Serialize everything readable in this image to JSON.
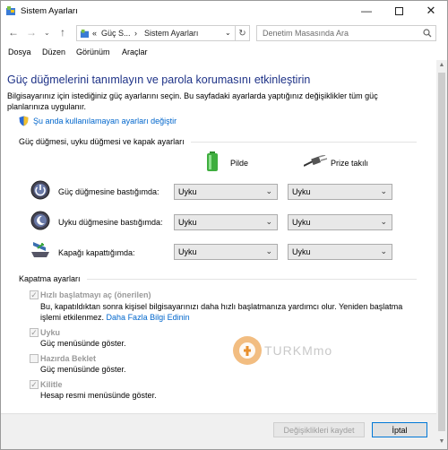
{
  "window": {
    "title": "Sistem Ayarları"
  },
  "address": {
    "overflow": "«",
    "crumb1": "Güç S...",
    "sep": "›",
    "crumb2": "Sistem Ayarları"
  },
  "search": {
    "placeholder": "Denetim Masasında Ara"
  },
  "menu": [
    "Dosya",
    "Düzen",
    "Görünüm",
    "Araçlar"
  ],
  "main": {
    "heading": "Güç düğmelerini tanımlayın ve parola korumasını etkinleştirin",
    "intro": "Bilgisayarınız için istediğiniz güç ayarlarını seçin. Bu sayfadaki ayarlarda yaptığınız değişiklikler tüm güç planlarınıza uygulanır.",
    "change_link": "Şu anda kullanılamayan ayarları değiştir",
    "section_power": "Güç düğmesi, uyku düğmesi ve kapak ayarları",
    "col_battery": "Pilde",
    "col_plugged": "Prize takılı",
    "rows": [
      {
        "label": "Güç düğmesine bastığımda:",
        "battery": "Uyku",
        "plugged": "Uyku"
      },
      {
        "label": "Uyku düğmesine bastığımda:",
        "battery": "Uyku",
        "plugged": "Uyku"
      },
      {
        "label": "Kapağı kapattığımda:",
        "battery": "Uyku",
        "plugged": "Uyku"
      }
    ],
    "section_shutdown": "Kapatma ayarları",
    "options": [
      {
        "label": "Hızlı başlatmayı aç (önerilen)",
        "checked": true,
        "desc1": "Bu, kapatıldıktan sonra kişisel bilgisayarınızı daha hızlı başlatmanıza yardımcı olur. Yeniden başlatma",
        "desc2": "işlemi etkilenmez.",
        "link": "Daha Fazla Bilgi Edinin"
      },
      {
        "label": "Uyku",
        "checked": true,
        "desc1": "Güç menüsünde göster."
      },
      {
        "label": "Hazırda Beklet",
        "checked": false,
        "desc1": "Güç menüsünde göster."
      },
      {
        "label": "Kilitle",
        "checked": true,
        "desc1": "Hesap resmi menüsünde göster."
      }
    ]
  },
  "watermark": {
    "text": "TURKMmo"
  },
  "footer": {
    "save": "Değişiklikleri kaydet",
    "cancel": "İptal"
  },
  "colors": {
    "heading": "#1e3287",
    "link": "#0066cc"
  }
}
